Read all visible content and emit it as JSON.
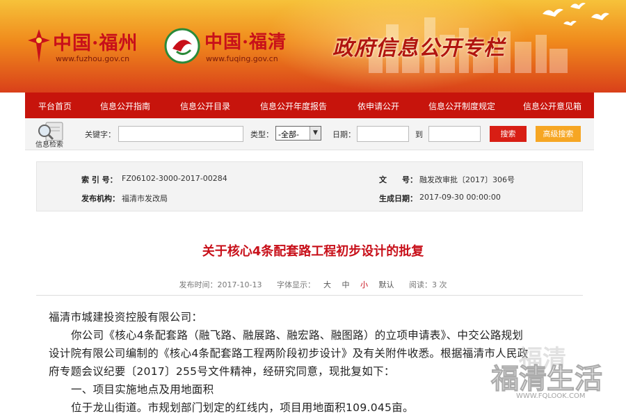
{
  "header": {
    "logo1_text": "中国·福州",
    "logo1_url": "www.fuzhou.gov.cn",
    "logo2_text": "中国·福清",
    "logo2_url": "www.fuqing.gov.cn",
    "title": "政府信息公开专栏"
  },
  "nav": {
    "items": [
      "平台首页",
      "信息公开指南",
      "信息公开目录",
      "信息公开年度报告",
      "依申请公开",
      "信息公开制度规定",
      "信息公开意见箱"
    ]
  },
  "search": {
    "icon_label": "信息检索",
    "keyword_label": "关键字：",
    "type_label": "类型：",
    "type_value": "-全部-",
    "date_label": "日期：",
    "to_label": "到",
    "search_button": "搜索",
    "advanced_button": "高级搜索"
  },
  "meta": {
    "index_label": "索 引 号：",
    "index_value": "FZ06102-3000-2017-00284",
    "docno_label": "文　　号：",
    "docno_value": "融发改审批〔2017〕306号",
    "org_label": "发布机构：",
    "org_value": "福清市发改局",
    "date_label": "生成日期：",
    "date_value": "2017-09-30 00:00:00"
  },
  "article": {
    "title": "关于核心4条配套路工程初步设计的批复",
    "publish_time": "发布时间：2017-10-13",
    "font_label": "字体显示：",
    "font_big": "大",
    "font_mid": "中",
    "font_small": "小",
    "font_default": "默认",
    "reads": "阅读：3 次",
    "lines": [
      "福清市城建投资控股有限公司：",
      "你公司《核心4条配套路（融飞路、融展路、融宏路、融图路）的立项申请表》、中交公路规划",
      "设计院有限公司编制的《核心4条配套路工程两阶段初步设计》及有关附件收悉。根据福清市人民政",
      "府专题会议纪要〔2017〕255号文件精神，经研究同意，现批复如下：",
      "一、项目实施地点及用地面积",
      "位于龙山街道。市规划部门划定的红线内，项目用地面积109.045亩。"
    ]
  },
  "watermark": {
    "line1": "福清",
    "line2": "福清生活",
    "line3": "WWW.FQLOOK.COM"
  }
}
